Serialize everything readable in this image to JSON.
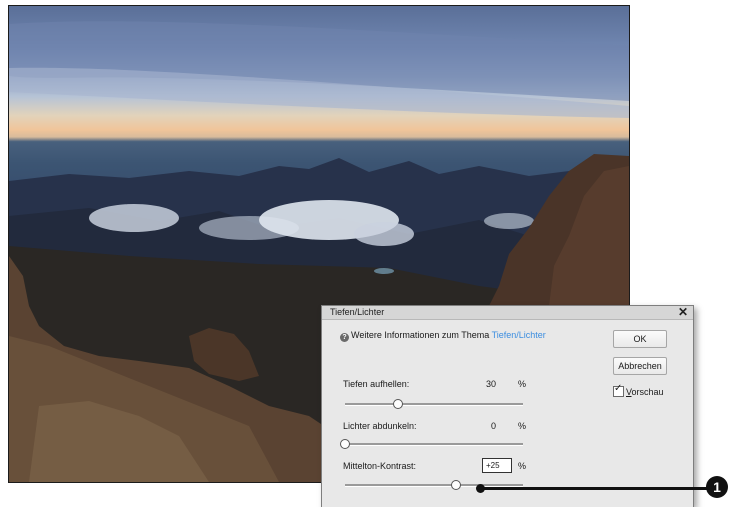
{
  "dialog": {
    "title": "Tiefen/Lichter",
    "close_glyph": "✕",
    "info_text": "Weitere Informationen zum Thema ",
    "info_link": "Tiefen/Lichter",
    "ok_label": "OK",
    "cancel_label": "Abbrechen",
    "preview_initial": "V",
    "preview_rest": "orschau",
    "preview_checked": true,
    "sliders": [
      {
        "label": "Tiefen aufhellen:",
        "value": "30",
        "unit": "%",
        "level": 0.3
      },
      {
        "label": "Lichter abdunkeln:",
        "value": "0",
        "unit": "%",
        "level": 0.0
      },
      {
        "label": "Mittelton-Kontrast:",
        "value": "+25",
        "unit": "%",
        "level": 0.625
      }
    ]
  },
  "callout": {
    "number": "1"
  },
  "icons": {
    "help": "help-icon",
    "close": "close-icon",
    "check": "checkmark-icon"
  },
  "colors": {
    "link": "#3c8ee0",
    "dialog_bg": "#e8e8e8"
  }
}
